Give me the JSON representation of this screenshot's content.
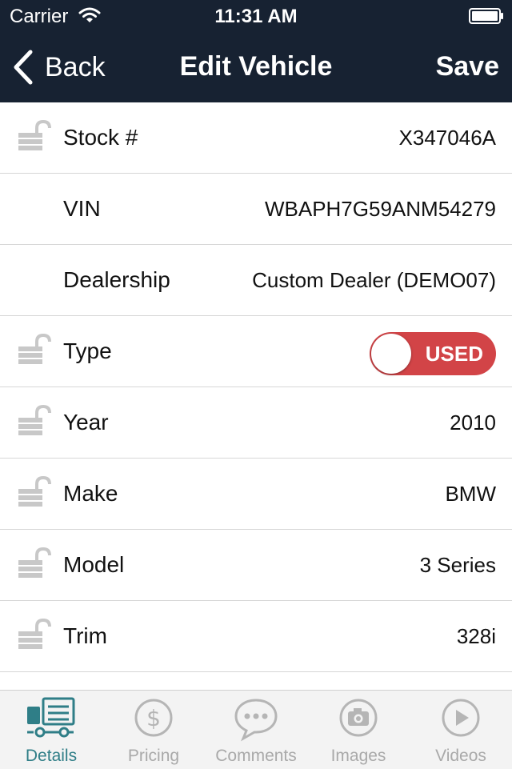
{
  "status_bar": {
    "carrier": "Carrier",
    "time": "11:31 AM"
  },
  "nav": {
    "back_label": "Back",
    "title": "Edit Vehicle",
    "save_label": "Save"
  },
  "rows": [
    {
      "label": "Stock #",
      "value": "X347046A",
      "lock": true
    },
    {
      "label": "VIN",
      "value": "WBAPH7G59ANM54279",
      "lock": false
    },
    {
      "label": "Dealership",
      "value": "Custom Dealer (DEMO07)",
      "lock": false
    },
    {
      "label": "Type",
      "value": "USED",
      "lock": true
    },
    {
      "label": "Year",
      "value": "2010",
      "lock": true
    },
    {
      "label": "Make",
      "value": "BMW",
      "lock": true
    },
    {
      "label": "Model",
      "value": "3 Series",
      "lock": true
    },
    {
      "label": "Trim",
      "value": "328i",
      "lock": true
    }
  ],
  "tabs": [
    {
      "label": "Details",
      "icon": "truck-icon",
      "active": true
    },
    {
      "label": "Pricing",
      "icon": "dollar-icon",
      "active": false
    },
    {
      "label": "Comments",
      "icon": "comment-icon",
      "active": false
    },
    {
      "label": "Images",
      "icon": "camera-icon",
      "active": false
    },
    {
      "label": "Videos",
      "icon": "play-icon",
      "active": false
    }
  ],
  "colors": {
    "nav_bg": "#172232",
    "toggle_red": "#d24447",
    "active_tab": "#2f7e87",
    "inactive_tab": "#a9a9a9"
  }
}
